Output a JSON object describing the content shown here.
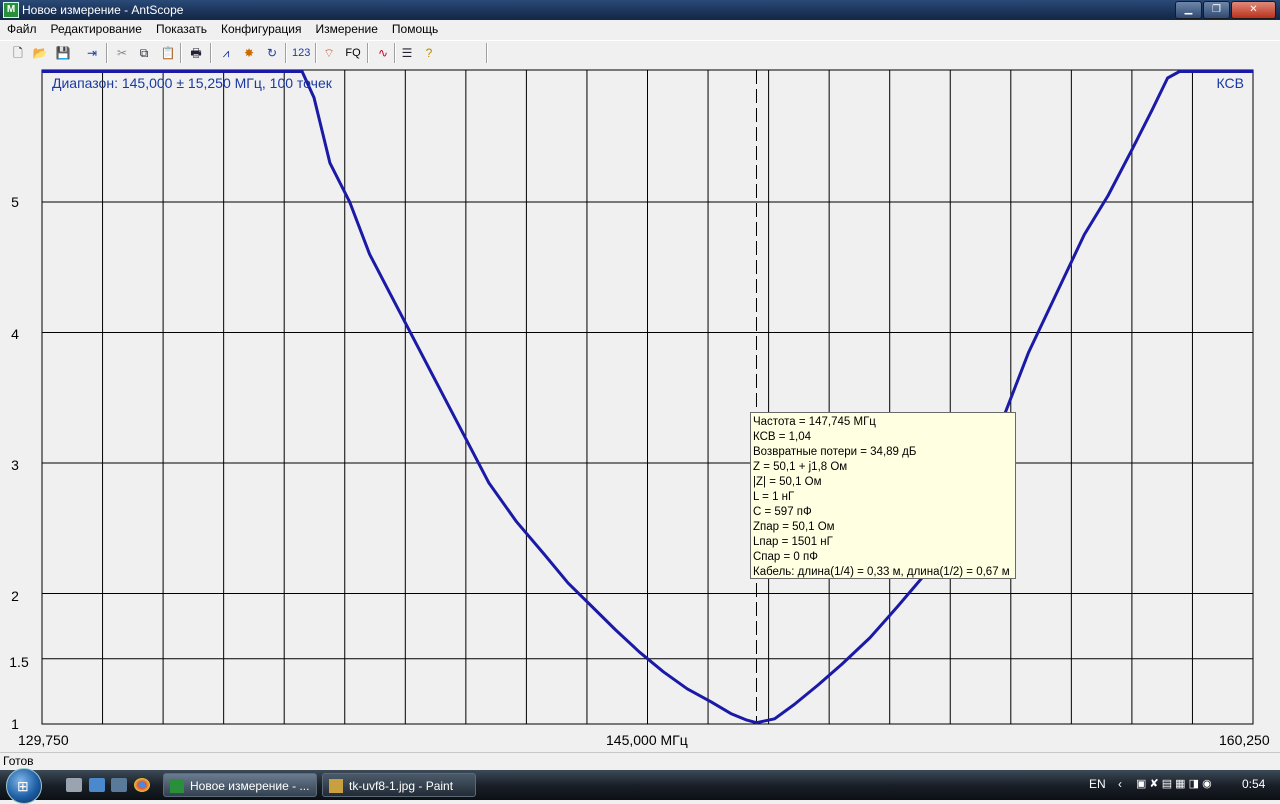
{
  "window": {
    "title": "Новое измерение - AntScope",
    "app_icon": "M"
  },
  "menu": [
    "Файл",
    "Редактирование",
    "Показать",
    "Конфигурация",
    "Измерение",
    "Помощь"
  ],
  "toolbar": {
    "icons": [
      "new-file-icon",
      "open-folder-icon",
      "save-disk-icon",
      "export-icon",
      "cut-icon",
      "copy-icon",
      "paste-icon",
      "print-icon",
      "chart-icon",
      "star-marker-icon",
      "refresh-icon",
      "numbers-icon",
      "antenna-icon",
      "fq-icon",
      "curve-icon",
      "list-icon",
      "help-icon"
    ],
    "numbers_label": "123",
    "fq_label": "FQ"
  },
  "chart": {
    "range_label": "Диапазон: 145,000 ± 15,250 МГц, 100 точек",
    "unit_label": "КСВ",
    "y_ticks": [
      "1",
      "1.5",
      "2",
      "3",
      "4",
      "5"
    ],
    "x_left": "129,750",
    "x_center": "145,000 МГц",
    "x_right": "160,250",
    "marker_freq_mhz": 147.745,
    "colors": {
      "curve": "#1a1aa6",
      "grid": "#000000",
      "background": "#f0f0f0"
    }
  },
  "chart_data": {
    "type": "line",
    "title": "",
    "xlabel": "МГц",
    "ylabel": "КСВ",
    "xlim": [
      129.75,
      160.25
    ],
    "ylim": [
      1,
      6
    ],
    "y_ticks": [
      1,
      1.5,
      2,
      3,
      4,
      5
    ],
    "grid": true,
    "series": [
      {
        "name": "КСВ",
        "x": [
          129.75,
          136.3,
          136.6,
          137.0,
          137.5,
          138.0,
          138.6,
          139.2,
          139.8,
          140.4,
          141.0,
          141.7,
          142.4,
          143.0,
          143.6,
          144.2,
          144.8,
          145.4,
          146.0,
          146.6,
          147.1,
          147.5,
          147.745,
          148.2,
          148.7,
          149.3,
          149.9,
          150.6,
          151.3,
          152.0,
          152.7,
          153.3,
          153.9,
          154.6,
          155.3,
          156.0,
          156.6,
          157.2,
          157.7,
          158.1,
          158.4,
          160.25
        ],
        "values": [
          6.0,
          6.0,
          5.8,
          5.3,
          5.0,
          4.6,
          4.25,
          3.9,
          3.55,
          3.2,
          2.85,
          2.55,
          2.3,
          2.08,
          1.9,
          1.72,
          1.55,
          1.4,
          1.27,
          1.17,
          1.08,
          1.03,
          1.01,
          1.04,
          1.15,
          1.3,
          1.46,
          1.66,
          1.9,
          2.15,
          2.5,
          2.9,
          3.3,
          3.85,
          4.3,
          4.75,
          5.05,
          5.4,
          5.7,
          5.95,
          6.0,
          6.0
        ]
      }
    ]
  },
  "tooltip": [
    "Частота = 147,745 МГц",
    "КСВ = 1,04",
    "Возвратные потери = 34,89 дБ",
    "Z = 50,1 + j1,8 Ом",
    "|Z| = 50,1 Ом",
    "L = 1 нГ",
    "C = 597 пФ",
    "Zпар = 50,1 Ом",
    "Lпар = 1501 нГ",
    "Cпар = 0 пФ",
    "Кабель: длина(1/4) = 0,33 м, длина(1/2) = 0,67 м"
  ],
  "status": "Готов",
  "taskbar": {
    "tasks": [
      "Новое измерение - ...",
      "tk-uvf8-1.jpg - Paint"
    ],
    "lang": "EN",
    "time": "0:54"
  }
}
